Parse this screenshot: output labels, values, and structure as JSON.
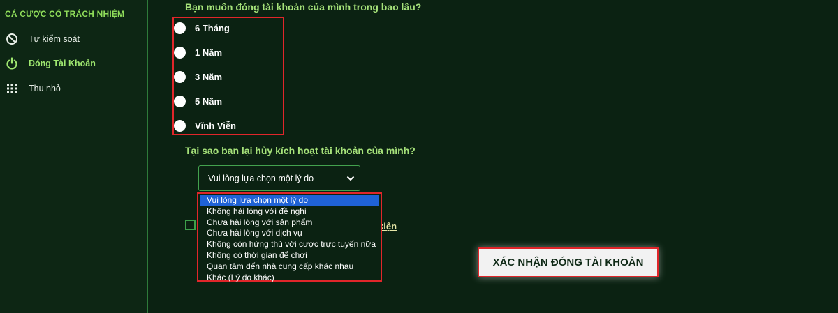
{
  "sidebar": {
    "title": "CÁ CƯỢC CÓ TRÁCH NHIỆM",
    "items": [
      {
        "label": "Tự kiểm soát",
        "icon": "ban-icon"
      },
      {
        "label": "Đóng Tài Khoản",
        "icon": "power-icon",
        "active": true
      },
      {
        "label": "Thu nhỏ",
        "icon": "grid-icon"
      }
    ]
  },
  "main": {
    "duration_question": "Bạn muốn đóng tài khoản của mình trong bao lâu?",
    "duration_options": [
      "6 Tháng",
      "1 Năm",
      "3 Năm",
      "5 Năm",
      "Vĩnh Viễn"
    ],
    "reason_question": "Tại sao bạn lại hủy kích hoạt tài khoản của mình?",
    "reason_select": {
      "value": "Vui lòng lựa chọn một lý do",
      "options": [
        "Vui lòng lựa chọn một lý do",
        "Không hài lòng với đề nghị",
        "Chưa hài lòng với sản phẩm",
        "Chưa hài lòng với dịch vụ",
        "Không còn hứng thú với cược trực tuyến nữa",
        "Không có thời gian để chơi",
        "Quan tâm đến nhà cung cấp khác nhau",
        "Khác (Lý do khác)"
      ]
    },
    "terms_link_fragment": "kiện",
    "confirm_label": "XÁC NHẬN ĐÓNG TÀI KHOẢN"
  },
  "colors": {
    "background": "#0b2212",
    "accent_green": "#a6e27a",
    "highlight_red": "#e0262a",
    "selected_blue": "#1f62d6"
  }
}
